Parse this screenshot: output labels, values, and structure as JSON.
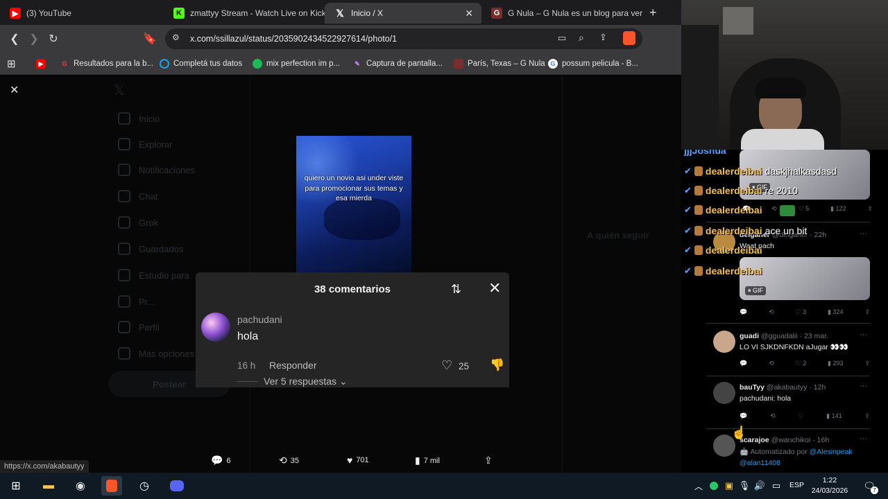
{
  "tabs": [
    {
      "label": "(3) YouTube",
      "icon": "youtube-icon",
      "color": "#ff0000"
    },
    {
      "label": "zmattyy Stream - Watch Live on Kick",
      "icon": "kick-icon",
      "color": "#53fc18"
    },
    {
      "label": "Inicio / X",
      "icon": "x-icon",
      "color": "#ffffff"
    },
    {
      "label": "G Nula – G Nula es un blog para ver",
      "icon": "gnula-icon",
      "color": "#b33"
    }
  ],
  "address": {
    "url": "x.com/ssillazul/status/2035902434522927614/photo/1"
  },
  "bookmarks": [
    {
      "label": "Resultados para la b..."
    },
    {
      "label": "Completá tus datos"
    },
    {
      "label": "mix perfection im p..."
    },
    {
      "label": "Captura de pantalla..."
    },
    {
      "label": "París, Texas – G Nula"
    },
    {
      "label": "possum pelicula - B..."
    }
  ],
  "x_sidebar": [
    "Inicio",
    "Explorar",
    "Notificaciones",
    "Chat",
    "Grok",
    "Guardados",
    "Estudio para",
    "Pr...",
    "Perfil",
    "Más opciones"
  ],
  "x_post_button": "Postear",
  "photo": {
    "overlay_text": "quiero un novio asi under viste para promocionar sus temas y esa mierda"
  },
  "comments": {
    "title": "38 comentarios",
    "user": "pachudani",
    "text": "hola",
    "time": "16 h",
    "reply": "Responder",
    "likes": "25",
    "more": "Ver 5 respuestas"
  },
  "stats": {
    "replies": "6",
    "reposts": "35",
    "likes": "701",
    "views": "7 mil"
  },
  "status_url": "https://x.com/akabautyy",
  "chat": [
    {
      "name": "jjjJoshua",
      "msg": ""
    },
    {
      "name": "dealerdeibai",
      "msg": "daskjhalkasdasd"
    },
    {
      "name": "dealerdeibai",
      "msg": "re 2010"
    },
    {
      "name": "dealerdeibai",
      "msg": ""
    },
    {
      "name": "dealerdeibai",
      "msg": "ace un bit"
    },
    {
      "name": "dealerdeibai",
      "msg": ""
    },
    {
      "name": "dealerdeibai",
      "msg": ""
    }
  ],
  "feed": {
    "top_stats": {
      "likes": "5",
      "views": "122"
    },
    "t1": {
      "name": "deiganer",
      "handle": "@deiganer · 22h",
      "text": "Waat pach",
      "likes": "3",
      "views": "324",
      "gif": "GIF"
    },
    "t2": {
      "name": "guadi",
      "handle": "@gguadalii · 23 mar.",
      "text": "LO VI SJKDNFKDN aJugar 👀👀",
      "likes": "2",
      "views": "293"
    },
    "t3": {
      "name": "bauTyy",
      "handle": "@akabautyy · 12h",
      "text": "pachudani: hola",
      "views": "141"
    },
    "t4": {
      "name": "scarajoe",
      "handle": "@wanchikoi · 16h",
      "text": "Automatizado por",
      "mention": "@Alesinpeak",
      "mention2": "@alan11408"
    }
  },
  "taskbar": {
    "lang": "ESP",
    "time": "1:22",
    "date": "24/03/2026",
    "notif_count": "7"
  }
}
